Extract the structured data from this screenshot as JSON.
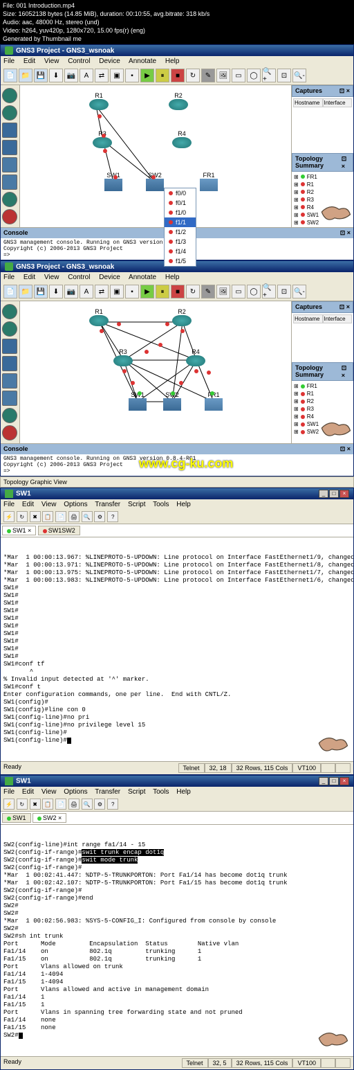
{
  "fileinfo": {
    "line1": "File: 001 Introduction.mp4",
    "line2": "Size: 16052138 bytes (14.85 MiB), duration: 00:10:55, avg.bitrate: 318 kb/s",
    "line3": "Audio: aac, 48000 Hz, stereo (und)",
    "line4": "Video: h264, yuv420p, 1280x720, 15.00 fps(r) (eng)",
    "line5": "Generated by Thumbnail me"
  },
  "gns3": {
    "title": "GNS3 Project - GNS3_wsnoak",
    "menu": [
      "File",
      "Edit",
      "View",
      "Control",
      "Device",
      "Annotate",
      "Help"
    ],
    "captures": {
      "title": "Captures",
      "col1": "Hostname",
      "col2": "Interface"
    },
    "topo": {
      "title": "Topology Summary",
      "items": [
        {
          "name": "FR1",
          "g": true
        },
        {
          "name": "R1",
          "g": false
        },
        {
          "name": "R2",
          "g": false
        },
        {
          "name": "R3",
          "g": false
        },
        {
          "name": "R4",
          "g": false
        },
        {
          "name": "SW1",
          "g": false
        },
        {
          "name": "SW2",
          "g": false
        }
      ]
    },
    "console": {
      "title": "Console",
      "line1": "GNS3 management console. Running on GNS3 version 0.8.4-RC1",
      "line2": "Copyright (c) 2006-2013 GNS3 Project",
      "prompt": "=>"
    },
    "devices": {
      "R1": "R1",
      "R2": "R2",
      "R3": "R3",
      "R4": "R4",
      "SW1": "SW1",
      "SW2": "SW2",
      "FR1": "FR1"
    },
    "ctx": [
      "f0/0",
      "f0/1",
      "f1/0",
      "f1/1",
      "f1/2",
      "f1/3",
      "f1/4",
      "f1/5"
    ]
  },
  "watermark": "www.cg-ku.com",
  "tgv": "Topology Graphic View",
  "term1": {
    "title": "SW1",
    "menu": [
      "File",
      "Edit",
      "View",
      "Options",
      "Transfer",
      "Script",
      "Tools",
      "Help"
    ],
    "tabs": [
      "SW1",
      "SW1SW2"
    ],
    "lines": [
      "*Mar  1 00:00:13.967: %LINEPROTO-5-UPDOWN: Line protocol on Interface FastEthernet1/9, changed state to down",
      "*Mar  1 00:00:13.971: %LINEPROTO-5-UPDOWN: Line protocol on Interface FastEthernet1/8, changed state to down",
      "*Mar  1 00:00:13.975: %LINEPROTO-5-UPDOWN: Line protocol on Interface FastEthernet1/7, changed state to down",
      "*Mar  1 00:00:13.983: %LINEPROTO-5-UPDOWN: Line protocol on Interface FastEthernet1/6, changed state to down",
      "SW1#",
      "SW1#",
      "SW1#",
      "SW1#",
      "SW1#",
      "SW1#",
      "SW1#",
      "SW1#",
      "SW1#",
      "SW1#",
      "SW1#conf tf",
      "       ^",
      "% Invalid input detected at '^' marker.",
      "",
      "SW1#conf t",
      "Enter configuration commands, one per line.  End with CNTL/Z.",
      "SW1(config)#",
      "SW1(config)#line con 0",
      "SW1(config-line)#no pri",
      "SW1(config-line)#no privilege level 15",
      "SW1(config-line)#",
      "SW1(config-line)#"
    ],
    "status": {
      "ready": "Ready",
      "proto": "Telnet",
      "rc": "32, 18",
      "size": "32 Rows, 115 Cols",
      "term": "VT100"
    }
  },
  "term2": {
    "title": "SW1",
    "tabs": [
      "SW1",
      "SW2"
    ],
    "hl1": "swit trunk encap dot1q",
    "hl2": "swit mode trunk",
    "lines_pre": [
      "SW2(config-line)#int range fa1/14 - 15",
      "SW2(config-if-range)#",
      "SW2(config-if-range)#",
      "SW2(config-if-range)#",
      "*Mar  1 00:02:41.447: %DTP-5-TRUNKPORTON: Port Fa1/14 has become dot1q trunk",
      "*Mar  1 00:02:42.107: %DTP-5-TRUNKPORTON: Port Fa1/15 has become dot1q trunk",
      "SW2(config-if-range)#",
      "SW2(config-if-range)#end",
      "SW2#",
      "SW2#",
      "*Mar  1 00:02:56.983: %SYS-5-CONFIG_I: Configured from console by console",
      "SW2#",
      "SW2#sh int trunk",
      "",
      "Port      Mode         Encapsulation  Status        Native vlan",
      "Fa1/14    on           802.1q         trunking      1",
      "Fa1/15    on           802.1q         trunking      1",
      "",
      "Port      Vlans allowed on trunk",
      "Fa1/14    1-4094",
      "Fa1/15    1-4094",
      "",
      "Port      Vlans allowed and active in management domain",
      "Fa1/14    1",
      "Fa1/15    1",
      "",
      "Port      Vlans in spanning tree forwarding state and not pruned",
      "Fa1/14    none",
      "Fa1/15    none",
      "SW2#"
    ],
    "status": {
      "ready": "Ready",
      "proto": "Telnet",
      "rc": "32, 5",
      "size": "32 Rows, 115 Cols",
      "term": "VT100"
    }
  }
}
